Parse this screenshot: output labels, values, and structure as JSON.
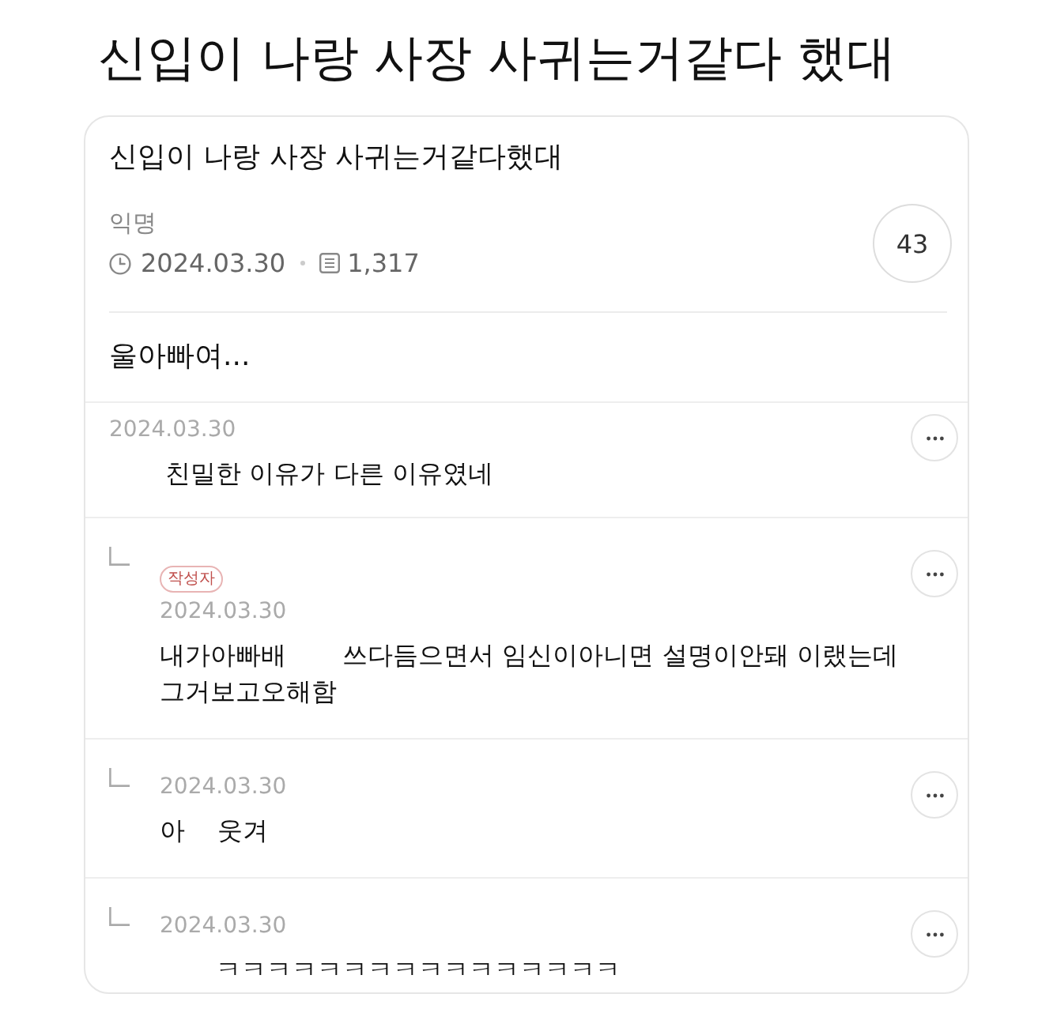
{
  "page_title": "신입이 나랑 사장 사귀는거같다 했대",
  "post": {
    "title": "신입이 나랑 사장 사귀는거같다했대",
    "author": "익명",
    "date": "2024.03.30",
    "views": "1,317",
    "count": "43",
    "body": "울아빠여..."
  },
  "comments": [
    {
      "kind": "comment",
      "date": "2024.03.30",
      "text": "       친밀한 이유가 다른 이유였네"
    },
    {
      "kind": "reply",
      "badge": "작성자",
      "date": "2024.03.30",
      "text": "내가아빠배       쓰다듬으면서 임신이아니면 설명이안돼 이랬는데\n그거보고오해함"
    },
    {
      "kind": "reply",
      "date": "2024.03.30",
      "text": "아    웃겨"
    },
    {
      "kind": "reply",
      "date": "2024.03.30",
      "text": "       ㅋㅋㅋㅋㅋㅋㅋㅋㅋㅋㅋㅋㅋㅋㅋㅋ"
    }
  ]
}
